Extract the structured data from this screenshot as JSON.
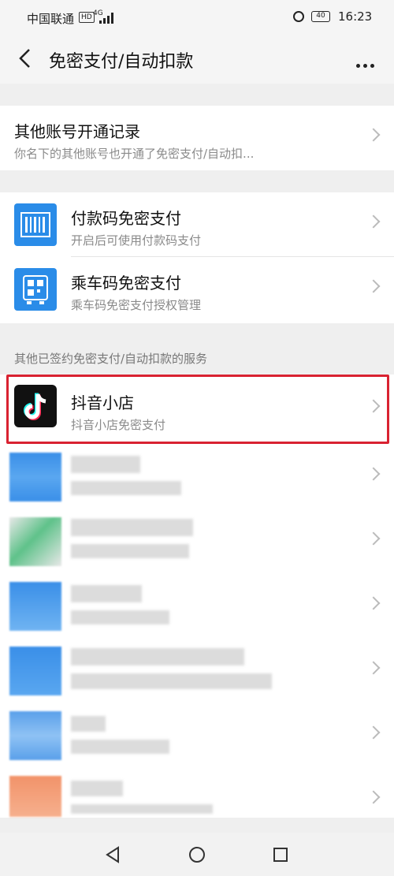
{
  "statusbar": {
    "carrier": "中国联通",
    "hd_badge": "HD",
    "network": "4G",
    "battery": "40",
    "time": "16:23"
  },
  "navbar": {
    "title": "免密支付/自动扣款"
  },
  "other_accounts": {
    "title": "其他账号开通记录",
    "subtitle": "你名下的其他账号也开通了免密支付/自动扣..."
  },
  "payment_code": {
    "title": "付款码免密支付",
    "subtitle": "开启后可使用付款码支付",
    "icon": "barcode-icon"
  },
  "ride_code": {
    "title": "乘车码免密支付",
    "subtitle": "乘车码免密支付授权管理",
    "icon": "bus-qrcode-icon"
  },
  "services_label": "其他已签约免密支付/自动扣款的服务",
  "douyin": {
    "title": "抖音小店",
    "subtitle": "抖音小店免密支付",
    "icon": "douyin-icon"
  },
  "colors": {
    "highlight": "#d92231",
    "accent": "#2a8ce8"
  }
}
